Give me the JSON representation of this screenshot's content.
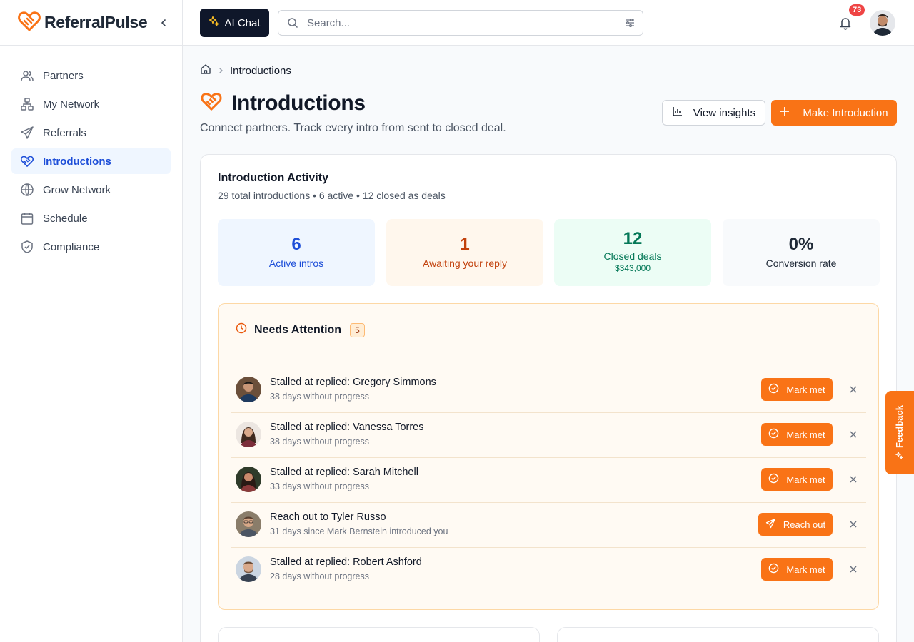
{
  "app": {
    "name": "ReferralPulse",
    "accent": "#f97316"
  },
  "sidebar": {
    "items": [
      {
        "label": "Partners",
        "icon": "users-icon",
        "active": false
      },
      {
        "label": "My Network",
        "icon": "network-icon",
        "active": false
      },
      {
        "label": "Referrals",
        "icon": "send-icon",
        "active": false
      },
      {
        "label": "Introductions",
        "icon": "handshake-icon",
        "active": true
      },
      {
        "label": "Grow Network",
        "icon": "globe-icon",
        "active": false
      },
      {
        "label": "Schedule",
        "icon": "calendar-icon",
        "active": false
      },
      {
        "label": "Compliance",
        "icon": "shield-icon",
        "active": false
      }
    ]
  },
  "topbar": {
    "ai_chat_label": "AI Chat",
    "search_placeholder": "Search...",
    "notification_count": "73"
  },
  "breadcrumb": {
    "current": "Introductions"
  },
  "page": {
    "title": "Introductions",
    "subtitle": "Connect partners. Track every intro from sent to closed deal.",
    "view_insights_label": "View insights",
    "make_intro_label": "Make Introduction"
  },
  "activity": {
    "title": "Introduction Activity",
    "summary": "29 total introductions • 6 active • 12 closed as deals",
    "stats": [
      {
        "value": "6",
        "label": "Active intros",
        "color": "#1d4ed8",
        "bg": "#eff6ff"
      },
      {
        "value": "1",
        "label": "Awaiting your reply",
        "color": "#c2410c",
        "bg": "#fff7ed"
      },
      {
        "value": "12",
        "label": "Closed deals",
        "extra": "$343,000",
        "color": "#047857",
        "bg": "#ecfdf5"
      },
      {
        "value": "0%",
        "label": "Conversion rate",
        "color": "#1f2937",
        "bg": "#f8fafc"
      }
    ]
  },
  "attention": {
    "title": "Needs Attention",
    "count": "5",
    "items": [
      {
        "title": "Stalled at replied: Gregory Simmons",
        "subtitle": "38 days without progress",
        "action": "Mark met",
        "action_icon": "check-circle-icon"
      },
      {
        "title": "Stalled at replied: Vanessa Torres",
        "subtitle": "38 days without progress",
        "action": "Mark met",
        "action_icon": "check-circle-icon"
      },
      {
        "title": "Stalled at replied: Sarah Mitchell",
        "subtitle": "33 days without progress",
        "action": "Mark met",
        "action_icon": "check-circle-icon"
      },
      {
        "title": "Reach out to Tyler Russo",
        "subtitle": "31 days since Mark Bernstein introduced you",
        "action": "Reach out",
        "action_icon": "send-icon"
      },
      {
        "title": "Stalled at replied: Robert Ashford",
        "subtitle": "28 days without progress",
        "action": "Mark met",
        "action_icon": "check-circle-icon"
      }
    ]
  },
  "feedback": {
    "label": "Feedback"
  }
}
